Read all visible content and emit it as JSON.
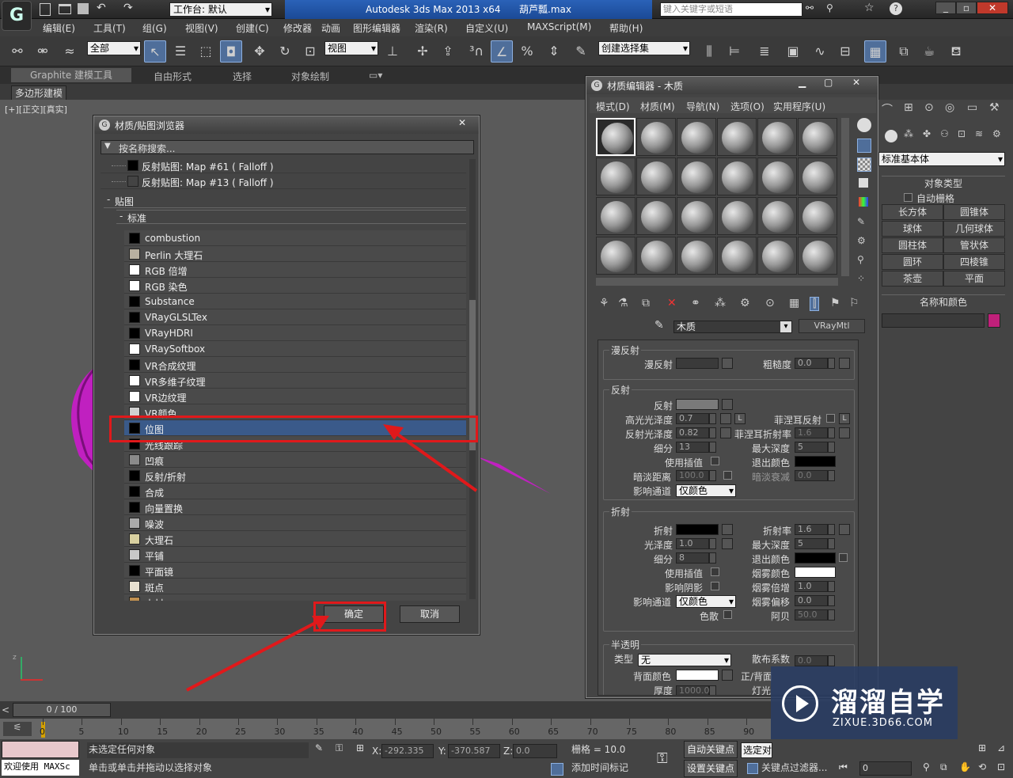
{
  "app": {
    "title": "Autodesk 3ds Max  2013 x64",
    "file": "葫芦瓢.max",
    "workspace": "工作台: 默认",
    "search_placeholder": "键入关键字或短语"
  },
  "menu": [
    "编辑(E)",
    "工具(T)",
    "组(G)",
    "视图(V)",
    "创建(C)",
    "修改器",
    "动画",
    "图形编辑器",
    "渲染(R)",
    "自定义(U)",
    "MAXScript(M)",
    "帮助(H)"
  ],
  "toolbar": {
    "filter": "全部",
    "refcoord": "视图",
    "selset": "创建选择集"
  },
  "ribbon": {
    "tabs": [
      "Graphite 建模工具",
      "自由形式",
      "选择",
      "对象绘制"
    ],
    "sub": "多边形建模"
  },
  "viewport": {
    "label": "[+][正交][真实]"
  },
  "browser": {
    "title": "材质/贴图浏览器",
    "search": "按名称搜索...",
    "top_items": [
      "反射贴图: Map #61 ( Falloff )",
      "反射贴图: Map #13 ( Falloff )"
    ],
    "group": "贴图",
    "subgroup": "标准",
    "items": [
      {
        "label": "combustion",
        "color": "#000000"
      },
      {
        "label": "Perlin 大理石",
        "color": "#b8b0a0"
      },
      {
        "label": "RGB 倍增",
        "color": "#ffffff"
      },
      {
        "label": "RGB 染色",
        "color": "#ffffff"
      },
      {
        "label": "Substance",
        "color": "#000000"
      },
      {
        "label": "VRayGLSLTex",
        "color": "#000000"
      },
      {
        "label": "VRayHDRI",
        "color": "#000000"
      },
      {
        "label": "VRaySoftbox",
        "color": "#ffffff"
      },
      {
        "label": "VR合成纹理",
        "color": "#000000"
      },
      {
        "label": "VR多维子纹理",
        "color": "#ffffff"
      },
      {
        "label": "VR边纹理",
        "color": "#ffffff"
      },
      {
        "label": "VR颜色",
        "color": "#d0d0d0"
      },
      {
        "label": "位图",
        "color": "#000000"
      },
      {
        "label": "光线跟踪",
        "color": "#000000"
      },
      {
        "label": "凹痕",
        "color": "#8a8a8a"
      },
      {
        "label": "反射/折射",
        "color": "#000000"
      },
      {
        "label": "合成",
        "color": "#000000"
      },
      {
        "label": "向量置换",
        "color": "#000000"
      },
      {
        "label": "噪波",
        "color": "#aaaaaa"
      },
      {
        "label": "大理石",
        "color": "#d8d0a0"
      },
      {
        "label": "平铺",
        "color": "#c8c8c8"
      },
      {
        "label": "平面镜",
        "color": "#000000"
      },
      {
        "label": "斑点",
        "color": "#e8e0d0"
      },
      {
        "label": "木材",
        "color": "#c09050"
      }
    ],
    "ok": "确定",
    "cancel": "取消"
  },
  "mateditor": {
    "title": "材质编辑器 - 木质",
    "menu": [
      "模式(D)",
      "材质(M)",
      "导航(N)",
      "选项(O)",
      "实用程序(U)"
    ],
    "material_name": "木质",
    "material_type": "VRayMtl",
    "diffuse": {
      "header": "漫反射",
      "diffuse": "漫反射",
      "roughness": "粗糙度",
      "roughness_val": "0.0"
    },
    "reflection": {
      "header": "反射",
      "reflect": "反射",
      "hilight_gloss": "高光光泽度",
      "hilight_val": "0.7",
      "L": "L",
      "fresnel": "菲涅耳反射",
      "refl_gloss": "反射光泽度",
      "refl_gloss_val": "0.82",
      "fresnel_ior": "菲涅耳折射率",
      "fresnel_ior_val": "1.6",
      "subdivs": "细分",
      "subdivs_val": "13",
      "max_depth": "最大深度",
      "max_depth_val": "5",
      "use_interp": "使用插值",
      "exit_color": "退出颜色",
      "dim_dist": "暗淡距离",
      "dim_dist_val": "100.0",
      "dim_falloff": "暗淡衰减",
      "dim_falloff_val": "0.0",
      "affect_ch": "影响通道",
      "affect_ch_val": "仅颜色"
    },
    "refraction": {
      "header": "折射",
      "refract": "折射",
      "ior": "折射率",
      "ior_val": "1.6",
      "gloss": "光泽度",
      "gloss_val": "1.0",
      "max_depth": "最大深度",
      "max_depth_val": "5",
      "subdivs": "细分",
      "subdivs_val": "8",
      "exit_color": "退出颜色",
      "use_interp": "使用插值",
      "fog_color": "烟雾颜色",
      "affect_shadows": "影响阴影",
      "fog_mult": "烟雾倍增",
      "fog_mult_val": "1.0",
      "affect_ch": "影响通道",
      "affect_ch_val": "仅颜色",
      "fog_bias": "烟雾偏移",
      "fog_bias_val": "0.0",
      "dispersion": "色散",
      "abbe": "阿贝",
      "abbe_val": "50.0"
    },
    "translucency": {
      "header": "半透明",
      "type": "类型",
      "type_val": "无",
      "scatter": "散布系数",
      "scatter_val": "0.0",
      "back_color": "背面颜色",
      "fwd_back": "正/背面",
      "thickness": "厚度",
      "thickness_val": "1000.0",
      "light_mult": "灯光"
    }
  },
  "cmdpanel": {
    "dropdown": "标准基本体",
    "obj_type": "对象类型",
    "autogrid": "自动栅格",
    "buttons": [
      "长方体",
      "圆锥体",
      "球体",
      "几何球体",
      "圆柱体",
      "管状体",
      "圆环",
      "四棱锥",
      "茶壶",
      "平面"
    ],
    "name_color": "名称和颜色"
  },
  "timeline": {
    "frame": "0 / 100",
    "ticks": [
      "0",
      "5",
      "10",
      "15",
      "20",
      "25",
      "30",
      "35",
      "40",
      "45",
      "50",
      "55",
      "60",
      "65",
      "70",
      "75",
      "80",
      "85",
      "90"
    ]
  },
  "status": {
    "welcome": "欢迎使用 MAXSc",
    "selected": "未选定任何对象",
    "hint": "单击或单击并拖动以选择对象",
    "x_label": "X:",
    "x": "-292.335",
    "y_label": "Y:",
    "y": "-370.587",
    "z_label": "Z:",
    "z": "0.0",
    "grid": "栅格 = 10.0",
    "autokey": "自动关键点",
    "setkey": "设置关键点",
    "selobj": "选定对象",
    "add_time_tag": "添加时间标记",
    "keyfilter": "关键点过滤器...",
    "frame": "0"
  },
  "watermark": {
    "cn": "溜溜自学",
    "url": "ZIXUE.3D66.COM"
  }
}
